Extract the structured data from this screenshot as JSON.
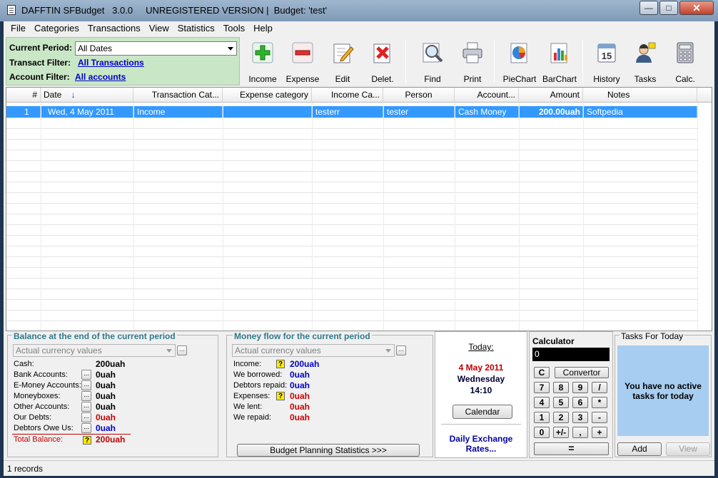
{
  "window": {
    "title": "DAFFTIN SFBudget   3.0.0     UNREGISTERED VERSION |  Budget: 'test'",
    "min": "—",
    "max": "□",
    "close": "✕"
  },
  "menu": [
    "File",
    "Categories",
    "Transactions",
    "View",
    "Statistics",
    "Tools",
    "Help"
  ],
  "filters": {
    "period_label": "Current Period:",
    "period_value": "All Dates",
    "transact_label": "Transact Filter:",
    "transact_value": "All Transactions",
    "account_label": "Account Filter:",
    "account_value": "All accounts"
  },
  "toolbar": {
    "income": "Income",
    "expense": "Expense",
    "edit": "Edit",
    "delete": "Delet.",
    "find": "Find",
    "print": "Print",
    "piechart": "PieChart",
    "barchart": "BarChart",
    "history": "History",
    "tasks": "Tasks",
    "calc": "Calc.",
    "calendar_day": "15"
  },
  "grid": {
    "columns": [
      "#",
      "Date",
      "Transaction Cat...",
      "Expense category",
      "Income Ca...",
      "Person",
      "Account...",
      "Amount",
      "Notes"
    ],
    "sort_indicator": "↓",
    "rows": [
      {
        "num": "1",
        "date": "Wed, 4 May 2011",
        "transaction_cat": "Income",
        "expense_cat": "",
        "income_cat": "testerr",
        "person": "tester",
        "account": "Cash Money",
        "amount": "200.00uah",
        "notes": "Softpedia"
      }
    ]
  },
  "balance": {
    "title": "Balance at the end of the current period",
    "currency": "Actual currency values",
    "more": "...",
    "cash_label": "Cash:",
    "cash_value": "200uah",
    "bank_label": "Bank Accounts:",
    "bank_value": "0uah",
    "emoney_label": "E-Money Accounts:",
    "emoney_value": "0uah",
    "moneybox_label": "Moneyboxes:",
    "moneybox_value": "0uah",
    "other_label": "Other Accounts:",
    "other_value": "0uah",
    "debts_label": "Our Debts:",
    "debts_value": "0uah",
    "debtors_label": "Debtors Owe Us:",
    "debtors_value": "0uah",
    "total_label": "Total Balance:",
    "total_value": "200uah",
    "q": "?"
  },
  "moneyflow": {
    "title": "Money flow for the current period",
    "currency": "Actual currency values",
    "more": "...",
    "income_label": "Income:",
    "income_value": "200uah",
    "borrowed_label": "We borrowed:",
    "borrowed_value": "0uah",
    "repaid_label": "Debtors repaid:",
    "repaid_value": "0uah",
    "expenses_label": "Expenses:",
    "expenses_value": "0uah",
    "lent_label": "We lent:",
    "lent_value": "0uah",
    "werepaid_label": "We repaid:",
    "werepaid_value": "0uah",
    "q": "?",
    "stats_button": "Budget Planning Statistics >>>"
  },
  "today": {
    "label": "Today:",
    "date": "4 May 2011",
    "weekday": "Wednesday",
    "time": "14:10",
    "calendar_button": "Calendar",
    "rates_line1": "Daily Exchange",
    "rates_line2": "Rates..."
  },
  "calculator": {
    "title": "Calculator",
    "display": "0",
    "clear": "C",
    "convertor": "Convertor",
    "keys": [
      [
        "7",
        "8",
        "9",
        "/"
      ],
      [
        "4",
        "5",
        "6",
        "*"
      ],
      [
        "1",
        "2",
        "3",
        "-"
      ],
      [
        "0",
        "+/-",
        ",",
        "+"
      ]
    ],
    "equals": "="
  },
  "tasks": {
    "title": "Tasks For Today",
    "message": "You have no active tasks for today",
    "add": "Add",
    "view": "View"
  },
  "status": {
    "records": "1 records"
  },
  "colors": {
    "accent_blue": "#0000cc",
    "negative_red": "#cc0000",
    "selection": "#3399ff",
    "filter_bg": "#c9e6c6",
    "tasks_bg": "#a7cdf0"
  }
}
